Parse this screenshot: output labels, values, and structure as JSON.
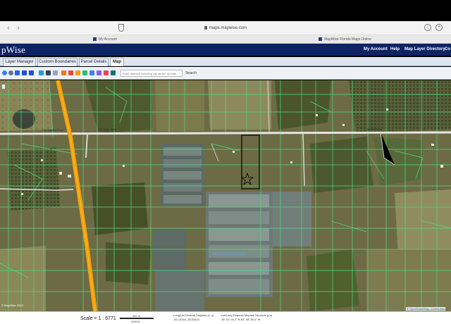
{
  "browser": {
    "back_icon": "‹",
    "forward_icon": "›",
    "url": "maps.mapwise.com",
    "download_icon": "↓",
    "extensions_icon": "+",
    "tabs": [
      {
        "label": "My Account"
      },
      {
        "label": "MapWise Florida Maps Online"
      }
    ]
  },
  "app": {
    "logo": "pWise",
    "top_links": [
      {
        "label": "My Account"
      },
      {
        "label": "Help"
      },
      {
        "label": "Map Layer Directory"
      },
      {
        "label": "Co"
      }
    ],
    "tabs": [
      {
        "label": "Layer Manager",
        "active": false
      },
      {
        "label": "Custom Boundaries",
        "active": false
      },
      {
        "label": "Parcel Details",
        "active": false
      },
      {
        "label": "Map",
        "active": true
      }
    ],
    "toolbar": {
      "address_placeholder": "Enter address including city and/or zipcode",
      "search_label": "Search"
    }
  },
  "map": {
    "road_labels": [
      {
        "text": "Old Hopewell Road"
      },
      {
        "text": "Old Tower Road"
      },
      {
        "text": "Old Hart Road"
      }
    ],
    "water_label": "DISMUKES WATER DISTRICT"
  },
  "status": {
    "copyright": "© MapWise 2023",
    "scale_ratio": "Scale = 1 : 6771",
    "scale_label_m": "200 m",
    "scale_label_ft": "1000 ft",
    "decimal_title": "Long/Lat Decimal Degrees (x, y)",
    "decimal_value": "-82.14316, 28.03422",
    "dms_title": "Lat/Long Degrees Minutes Seconds (y,x)",
    "dms_value": "28° 02' 03.2\" N 82° 08' 35.4\" W",
    "osm_link": "© OpenStreetMap contributors"
  },
  "colors": {
    "header_bg": "#0d2366",
    "parcel_lines": "#4ade80",
    "highway": "#f59e0b",
    "selected_parcel": "#000000"
  }
}
